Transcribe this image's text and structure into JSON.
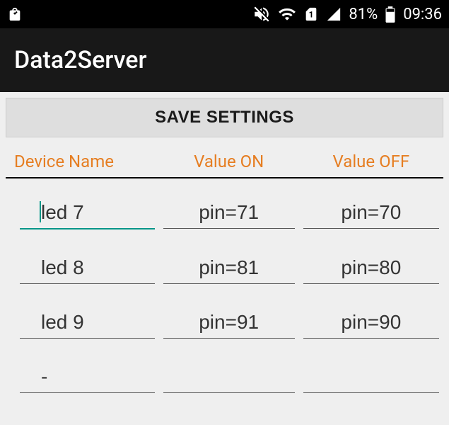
{
  "status_bar": {
    "battery_percent": "81%",
    "time": "09:36"
  },
  "app": {
    "title": "Data2Server"
  },
  "actions": {
    "save_label": "SAVE SETTINGS"
  },
  "table": {
    "headers": {
      "name": "Device Name",
      "on": "Value ON",
      "off": "Value OFF"
    },
    "rows": [
      {
        "name": "led 7",
        "on": "pin=71",
        "off": "pin=70",
        "focused": true
      },
      {
        "name": "led 8",
        "on": "pin=81",
        "off": "pin=80",
        "focused": false
      },
      {
        "name": "led 9",
        "on": "pin=91",
        "off": "pin=90",
        "focused": false
      },
      {
        "name": "-",
        "on": "",
        "off": "",
        "focused": false
      }
    ]
  }
}
